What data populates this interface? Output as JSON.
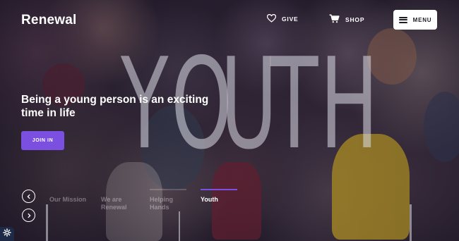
{
  "header": {
    "logo": "Renewal",
    "give_label": "GIVE",
    "shop_label": "SHOP",
    "menu_label": "MENU"
  },
  "hero": {
    "big_word": [
      "Y",
      "O",
      "U",
      "T",
      "H"
    ],
    "headline": "Being a young person is an exciting time in life",
    "cta_label": "JOIN IN"
  },
  "slides": {
    "tabs": [
      {
        "label": "Our Mission",
        "active": false
      },
      {
        "label": "We are Renewal",
        "active": false
      },
      {
        "label": "Helping Hands",
        "active": false
      },
      {
        "label": "Youth",
        "active": true
      }
    ]
  },
  "icons": {
    "give": "heart-icon",
    "shop": "cart-icon",
    "menu": "hamburger-icon",
    "prev": "chevron-left-icon",
    "next": "chevron-right-icon",
    "settings": "gear-icon"
  },
  "colors": {
    "accent": "#7b4fe0",
    "text": "#ffffff",
    "menu_bg": "#ffffff",
    "settings_bg": "#1e2a46"
  }
}
